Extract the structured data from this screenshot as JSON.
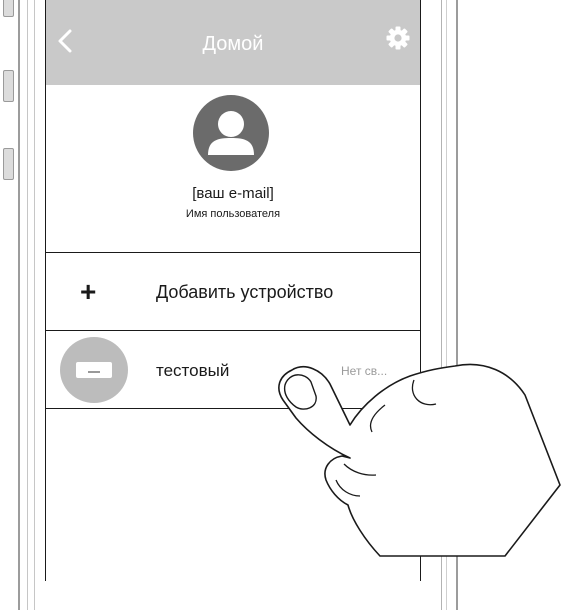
{
  "header": {
    "title": "Домой",
    "back_icon": "chevron-left-icon",
    "settings_icon": "gear-icon"
  },
  "profile": {
    "avatar_icon": "user-icon",
    "email": "[ваш e-mail]",
    "username": "Имя пользователя"
  },
  "add_device": {
    "icon": "plus-icon",
    "label": "Добавить устройство"
  },
  "devices": [
    {
      "icon": "air-conditioner-icon",
      "name": "тестовый",
      "status": "Нет св..."
    }
  ],
  "colors": {
    "header_bg": "#c9c9c9",
    "avatar": "#6b6b6b",
    "device_circle": "#bcbcbc",
    "status_text": "#9a9a9a"
  }
}
